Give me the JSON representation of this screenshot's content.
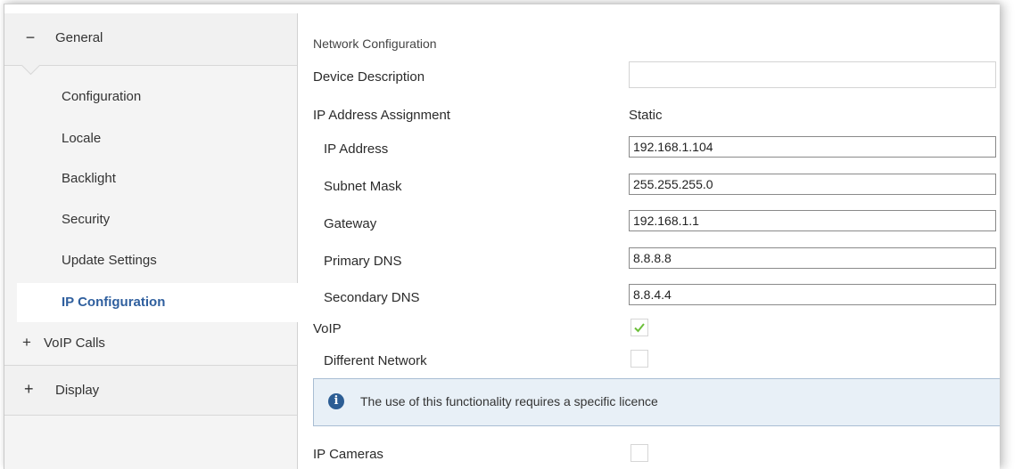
{
  "sidebar": {
    "general": {
      "sign": "−",
      "label": "General"
    },
    "items": [
      {
        "label": "Configuration"
      },
      {
        "label": "Locale"
      },
      {
        "label": "Backlight"
      },
      {
        "label": "Security"
      },
      {
        "label": "Update Settings"
      },
      {
        "label": "IP Configuration"
      }
    ],
    "voip_calls": {
      "sign": "+",
      "label": "VoIP Calls"
    },
    "display": {
      "sign": "+",
      "label": "Display"
    }
  },
  "main": {
    "section_title": "Network Configuration",
    "device_description": {
      "label": "Device Description",
      "value": ""
    },
    "ip_assignment": {
      "label": "IP Address Assignment",
      "value": "Static"
    },
    "ip_address": {
      "label": "IP Address",
      "value": "192.168.1.104"
    },
    "subnet_mask": {
      "label": "Subnet Mask",
      "value": "255.255.255.0"
    },
    "gateway": {
      "label": "Gateway",
      "value": "192.168.1.1"
    },
    "primary_dns": {
      "label": "Primary DNS",
      "value": "8.8.8.8"
    },
    "secondary_dns": {
      "label": "Secondary DNS",
      "value": "8.8.4.4"
    },
    "voip": {
      "label": "VoIP",
      "checked": true
    },
    "different_network": {
      "label": "Different Network",
      "checked": false
    },
    "info": {
      "icon": "info-icon",
      "glyph": "i",
      "text": "The use of this functionality requires a specific licence"
    },
    "ip_cameras": {
      "label": "IP Cameras",
      "checked": false
    }
  },
  "colors": {
    "accent": "#2f5f9e",
    "check": "#6cbf3a",
    "info_bg": "#e8f0f7",
    "info_icon": "#2c5d94"
  }
}
